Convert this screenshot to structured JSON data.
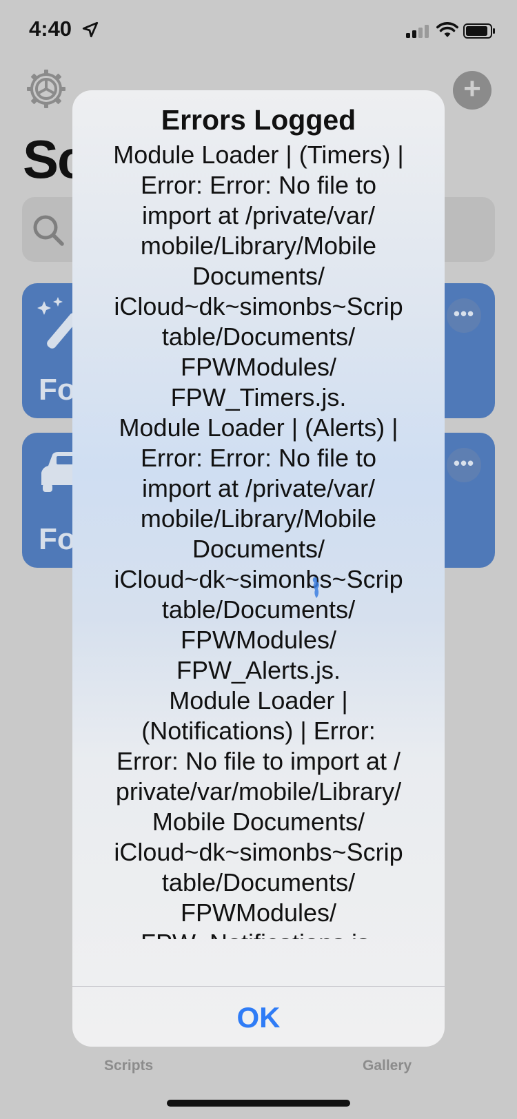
{
  "status_bar": {
    "time": "4:40"
  },
  "header": {
    "title": "Sc"
  },
  "cards": [
    {
      "title": "Fo",
      "icon": "magic-wand-icon",
      "color": "#4f79b8"
    },
    {
      "title": "Fo",
      "icon": "car-icon",
      "color": "#4f79b8"
    }
  ],
  "tabbar": {
    "scripts_label": "Scripts",
    "gallery_label": "Gallery"
  },
  "alert": {
    "title": "Errors Logged",
    "message": "Module Loader | (Timers) |\nError: Error: No file to\nimport at /private/var/\nmobile/Library/Mobile\nDocuments/\niCloud~dk~simonbs~Scrip\ntable/Documents/\nFPWModules/\nFPW_Timers.js.\nModule Loader | (Alerts) |\nError: Error: No file to\nimport at /private/var/\nmobile/Library/Mobile\nDocuments/\niCloud~dk~simonbs~Scrip\ntable/Documents/\nFPWModules/\nFPW_Alerts.js.\nModule Loader |\n(Notifications) | Error:\nError: No file to import at /\nprivate/var/mobile/Library/\nMobile Documents/\niCloud~dk~simonbs~Scrip\ntable/Documents/\nFPWModules/\nFPW_Notifications.js.\nModule Loader | (Files) |",
    "ok_label": "OK",
    "ok_color": "#2f7cf6"
  }
}
